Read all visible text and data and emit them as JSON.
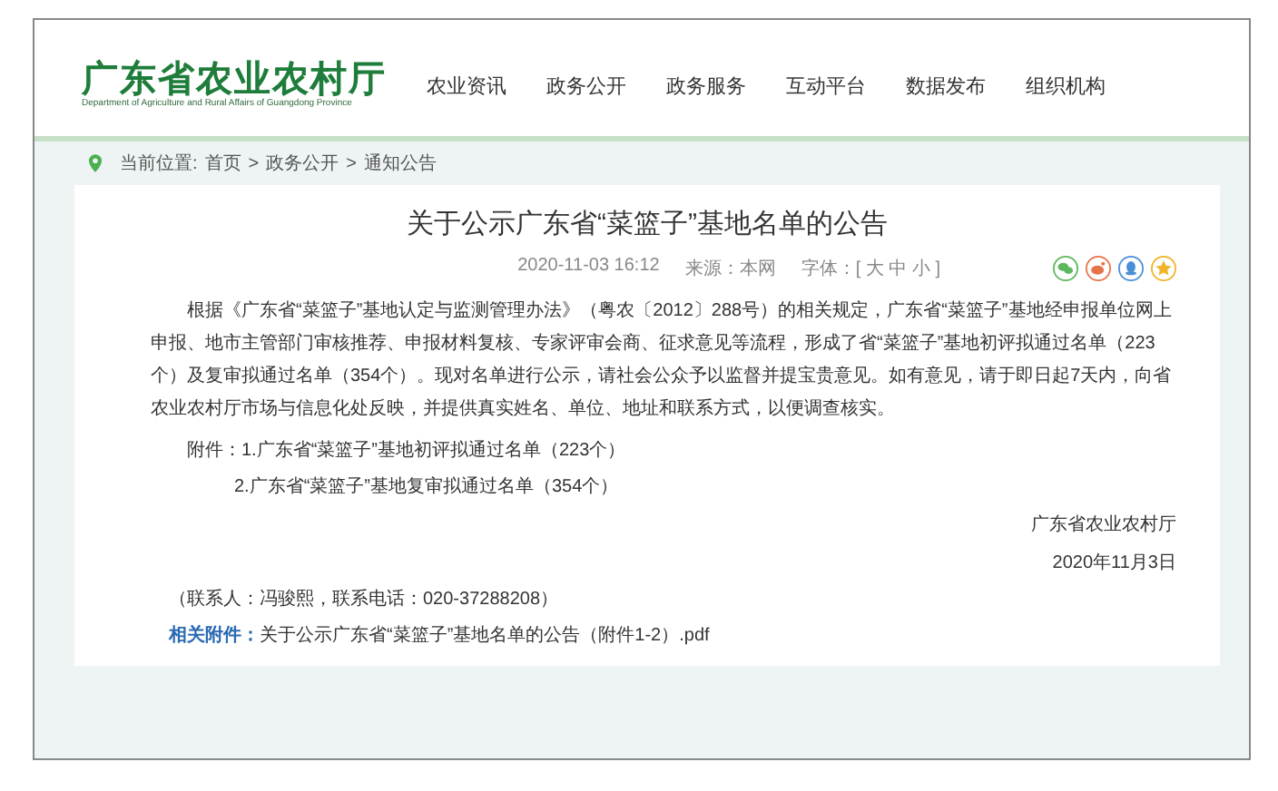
{
  "site": {
    "logo_title": "广东省农业农村厅",
    "logo_subtitle": "Department of Agriculture and Rural Affairs of Guangdong Province"
  },
  "nav": [
    {
      "label": "农业资讯"
    },
    {
      "label": "政务公开"
    },
    {
      "label": "政务服务"
    },
    {
      "label": "互动平台"
    },
    {
      "label": "数据发布"
    },
    {
      "label": "组织机构"
    }
  ],
  "breadcrumb": {
    "prefix": "当前位置:",
    "items": [
      {
        "label": "首页"
      },
      {
        "separator": ">",
        "label": "政务公开"
      },
      {
        "separator": ">",
        "label": "通知公告"
      }
    ]
  },
  "article": {
    "title": "关于公示广东省“菜篮子”基地名单的公告",
    "date": "2020-11-03 16:12",
    "source": "来源：本网",
    "font_size": "字体：[ 大  中  小 ]",
    "share": [
      {
        "kind": "wechat",
        "color": "#5cb85c"
      },
      {
        "kind": "weibo",
        "color": "#e8734a"
      },
      {
        "kind": "qq",
        "color": "#4a90d9"
      },
      {
        "kind": "favorite",
        "color": "#f0b429"
      }
    ],
    "paragraphs": [
      "根据《广东省“菜篮子”基地认定与监测管理办法》（粤农〔2012〕288号）的相关规定，广东省“菜篮子”基地经申报单位网上申报、地市主管部门审核推荐、申报材料复核、专家评审会商、征求意见等流程，形成了省“菜篮子”基地初评拟通过名单（223个）及复审拟通过名单（354个）。现对名单进行公示，请社会公众予以监督并提宝贵意见。如有意见，请于即日起7天内，向省农业农村厅市场与信息化处反映，并提供真实姓名、单位、地址和联系方式，以便调查核实。"
    ],
    "attachments_label": "附件：",
    "attachments": [
      "1.广东省“菜篮子”基地初评拟通过名单（223个）",
      "2.广东省“菜篮子”基地复审拟通过名单（354个）"
    ],
    "signature": "广东省农业农村厅",
    "signature_date": "2020年11月3日",
    "contact": "（联系人：冯骏熙，联系电话：020-37288208）",
    "related_label": "相关附件：",
    "related_link": "关于公示广东省“菜篮子”基地名单的公告（附件1-2）.pdf"
  }
}
